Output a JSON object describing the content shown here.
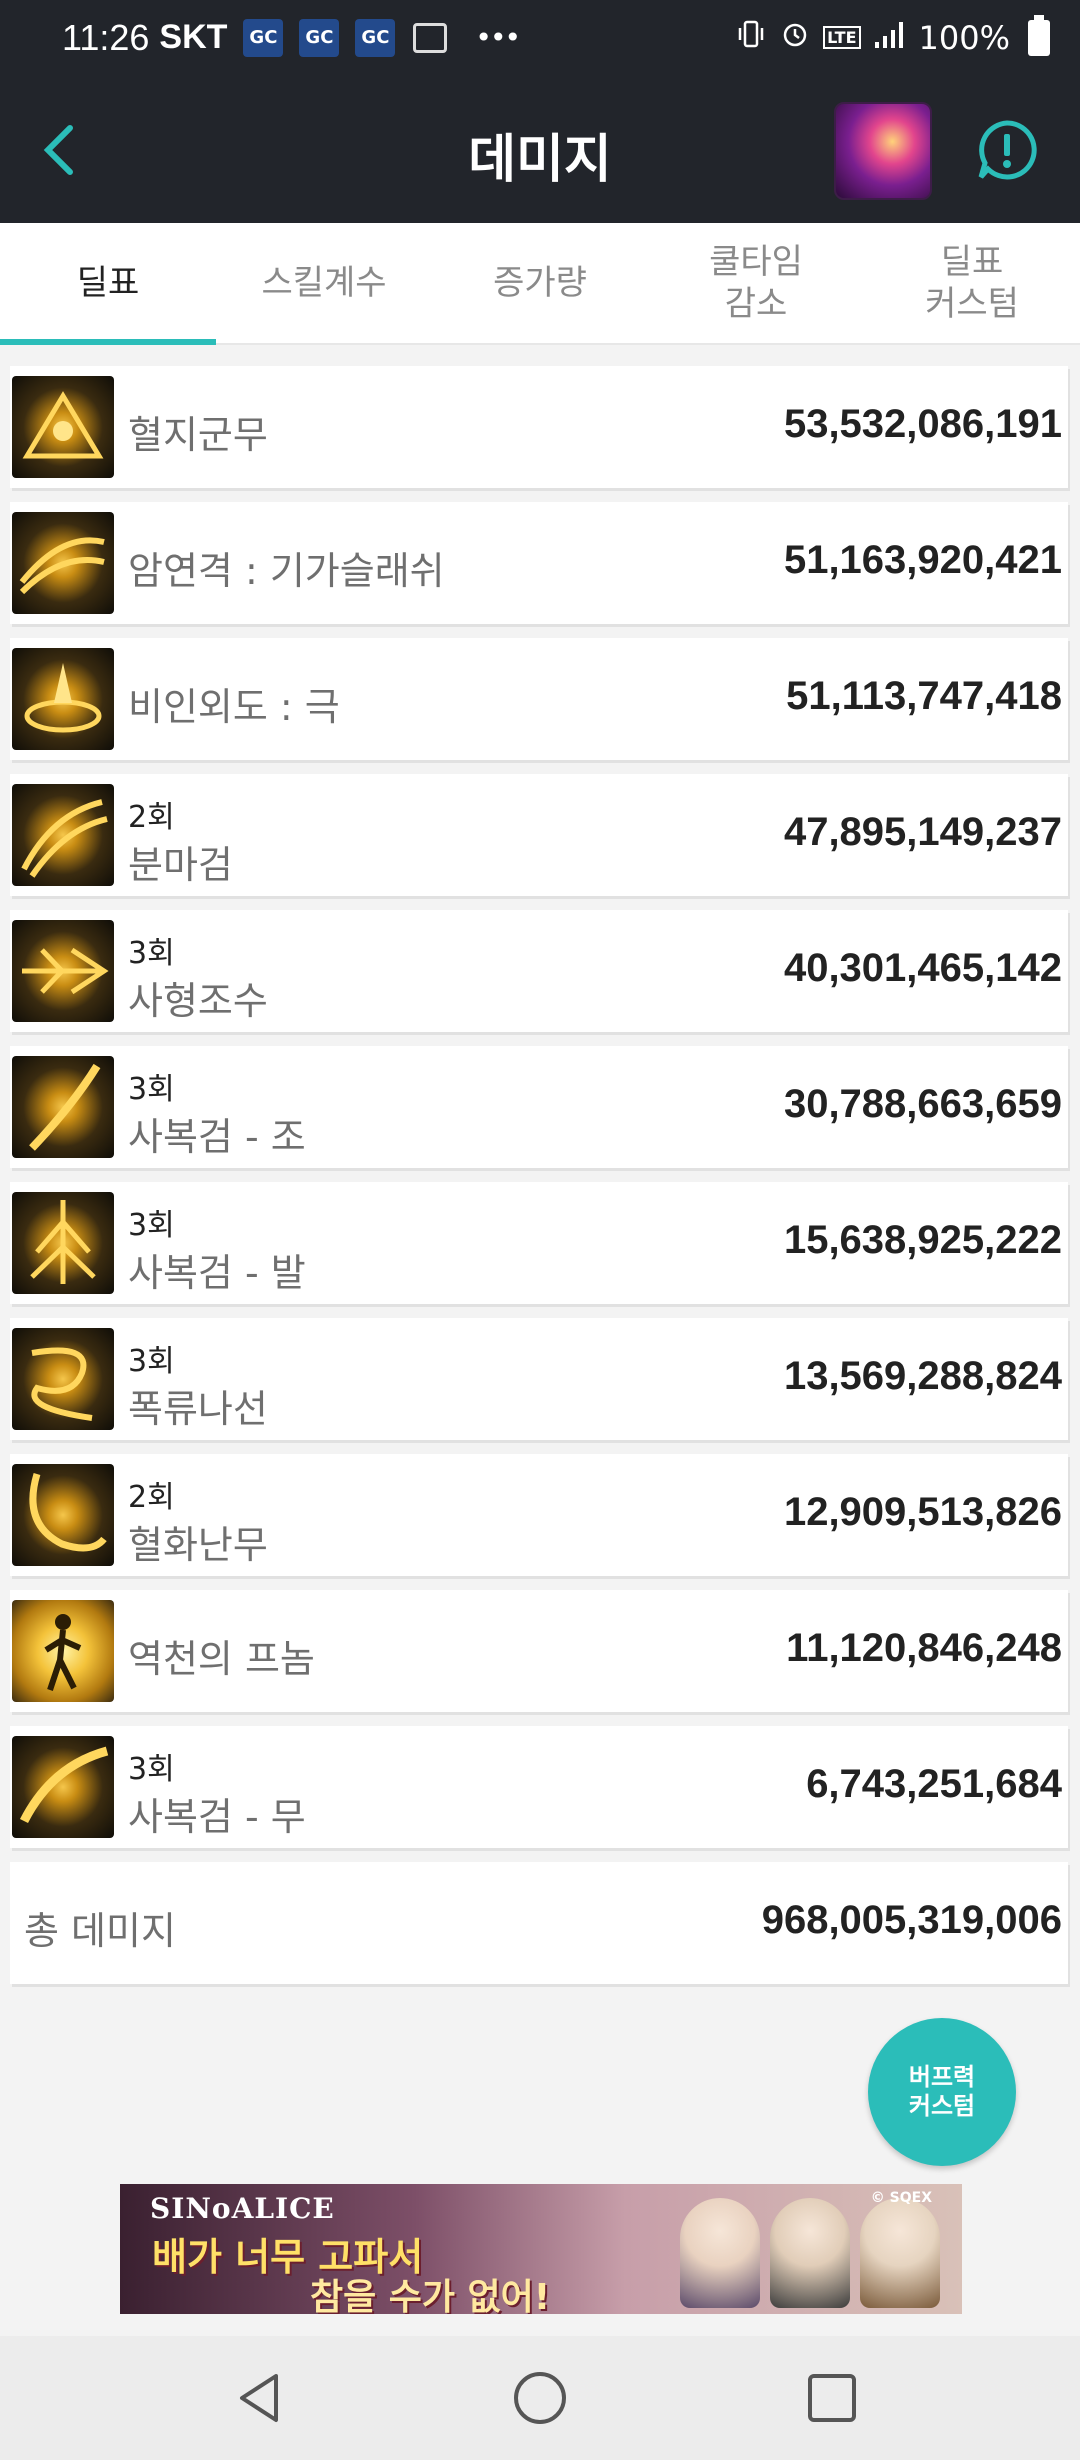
{
  "status_bar": {
    "time": "11:26",
    "carrier": "SKT",
    "battery": "100%",
    "network": "LTE"
  },
  "header": {
    "title": "데미지",
    "colors": {
      "bar": "#22252b",
      "accent": "#2bbdb9"
    }
  },
  "tabs": [
    {
      "label": "딜표",
      "active": true
    },
    {
      "label": "스킬계수",
      "active": false
    },
    {
      "label": "증가량",
      "active": false
    },
    {
      "label": "쿨타임\n감소",
      "active": false
    },
    {
      "label": "딜표\n커스텀",
      "active": false
    }
  ],
  "damage_list": [
    {
      "count": "",
      "name": "혈지군무",
      "value": "53,532,086,191"
    },
    {
      "count": "",
      "name": "암연격 : 기가슬래쉬",
      "value": "51,163,920,421"
    },
    {
      "count": "",
      "name": "비인외도 : 극",
      "value": "51,113,747,418"
    },
    {
      "count": "2회",
      "name": "분마검",
      "value": "47,895,149,237"
    },
    {
      "count": "3회",
      "name": "사형조수",
      "value": "40,301,465,142"
    },
    {
      "count": "3회",
      "name": "사복검 - 조",
      "value": "30,788,663,659"
    },
    {
      "count": "3회",
      "name": "사복검 - 발",
      "value": "15,638,925,222"
    },
    {
      "count": "3회",
      "name": "폭류나선",
      "value": "13,569,288,824"
    },
    {
      "count": "2회",
      "name": "혈화난무",
      "value": "12,909,513,826"
    },
    {
      "count": "",
      "name": "역천의 프놈",
      "value": "11,120,846,248"
    },
    {
      "count": "3회",
      "name": "사복검 - 무",
      "value": "6,743,251,684"
    }
  ],
  "total": {
    "label": "총 데미지",
    "value": "968,005,319,006"
  },
  "fab": {
    "label": "버프력\n커스텀"
  },
  "banner": {
    "logo": "SINoALICE",
    "line1": "배가 너무 고파서",
    "line2": "참을 수가 없어!",
    "copyright": "© SQEX"
  }
}
